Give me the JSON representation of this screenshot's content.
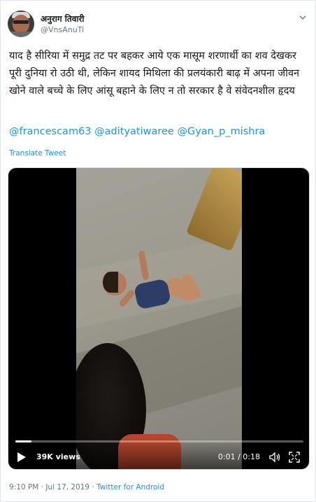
{
  "author": {
    "display_name": "अनुराग तिवारी",
    "handle": "@VnsAnuTi"
  },
  "tweet": {
    "text": "याद है सीरिया में समुद्र तट पर बहकर आये एक मासूम शरणार्थी का शव देखकर पूरी दुनिया रो उठी थी, लेकिन शायद मिथिला की प्रलयंकारी बाढ़ में अपना जीवन खोने वाले बच्चे के लिए आंसू बहाने के लिए न तो सरकार है वे संवेदनशील हृदय",
    "mentions": [
      "@francescam63",
      "@adityatiwaree",
      "@Gyan_p_mishra"
    ],
    "translate_label": "Translate Tweet"
  },
  "video": {
    "views": "39K views",
    "time": "0:01 / 0:18",
    "progress_fraction": 0.056
  },
  "footer": {
    "timestamp": "9:10 PM · Jul 17, 2019 · ",
    "source": "Twitter for Android"
  },
  "colors": {
    "link": "#1b95e0",
    "secondary_text": "#657786"
  },
  "icons": [
    "chevron-down-icon",
    "play-icon",
    "volume-icon",
    "fullscreen-icon"
  ]
}
